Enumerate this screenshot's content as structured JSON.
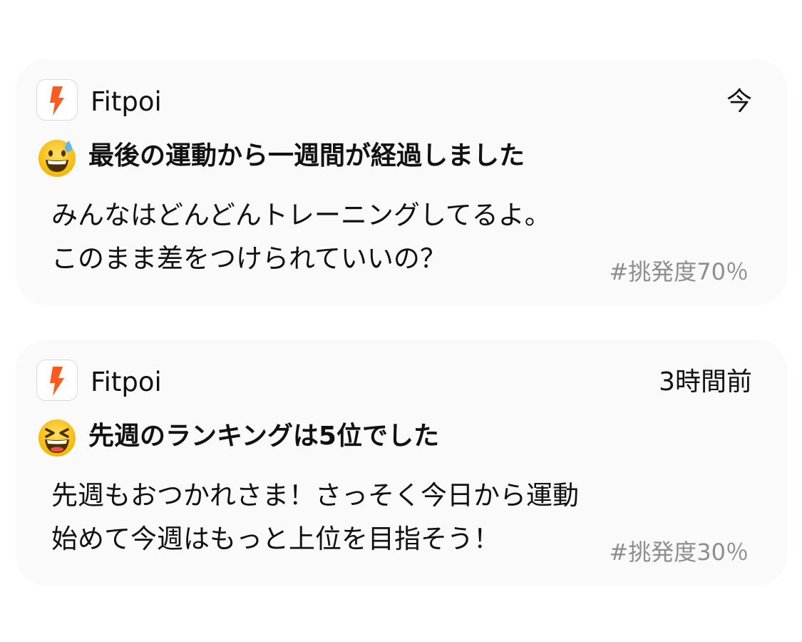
{
  "notifications": [
    {
      "app_name": "Fitpoi",
      "app_icon": "fitpoi-logo-icon",
      "time": "今",
      "emoji": "grinning-face-with-sweat-icon",
      "title": "最後の運動から一週間が経過しました",
      "body_line1": "みんなはどんどんトレーニングしてるよ。",
      "body_line2": "このまま差をつけられていいの？",
      "tag": "#挑発度70％"
    },
    {
      "app_name": "Fitpoi",
      "app_icon": "fitpoi-logo-icon",
      "time": "3時間前",
      "emoji": "grinning-squinting-face-icon",
      "title": "先週のランキングは5位でした",
      "body_line1": "先週もおつかれさま！さっそく今日から運動",
      "body_line2": "始めて今週はもっと上位を目指そう！",
      "tag": "#挑発度30％"
    }
  ],
  "colors": {
    "card_background": "#fafafa",
    "brand_accent": "#ff5a1f",
    "tag_text": "#8e8e8e",
    "emoji_yellow": "#ffcc33",
    "sweat_blue": "#5fb6f5"
  }
}
